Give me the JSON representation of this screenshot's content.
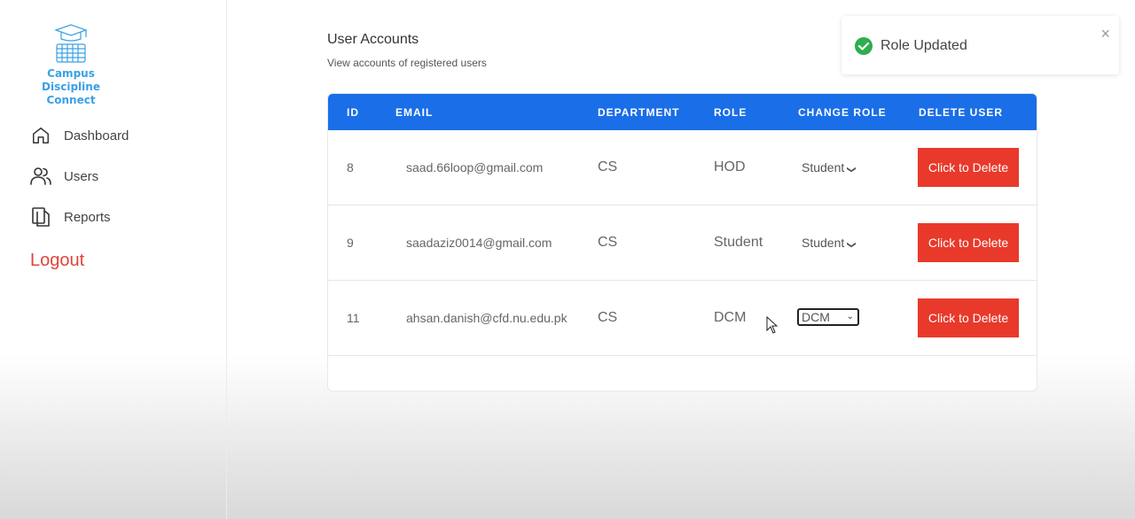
{
  "app": {
    "name": "Campus Discipline Connect"
  },
  "sidebar": {
    "items": [
      {
        "label": "Dashboard",
        "icon": "home-icon"
      },
      {
        "label": "Users",
        "icon": "users-icon"
      },
      {
        "label": "Reports",
        "icon": "reports-icon"
      }
    ],
    "logout_label": "Logout"
  },
  "main": {
    "title": "User Accounts",
    "subtitle": "View accounts of registered users",
    "table": {
      "headers": [
        "ID",
        "EMAIL",
        "DEPARTMENT",
        "ROLE",
        "CHANGE ROLE",
        "DELETE USER"
      ],
      "rows": [
        {
          "id": "8",
          "email": "saad.66loop@gmail.com",
          "department": "CS",
          "role": "HOD",
          "change_role": "Student",
          "delete_label": "Click to Delete"
        },
        {
          "id": "9",
          "email": "saadaziz0014@gmail.com",
          "department": "CS",
          "role": "Student",
          "change_role": "Student",
          "delete_label": "Click to Delete"
        },
        {
          "id": "11",
          "email": "ahsan.danish@cfd.nu.edu.pk",
          "department": "CS",
          "role": "DCM",
          "change_role": "DCM",
          "delete_label": "Click to Delete"
        }
      ]
    }
  },
  "toast": {
    "message": "Role Updated",
    "close": "×"
  },
  "colors": {
    "header": "#1a6ee8",
    "delete": "#e8392b",
    "logout": "#e0443a",
    "success": "#2eae4e",
    "brand": "#3aa0e6"
  }
}
